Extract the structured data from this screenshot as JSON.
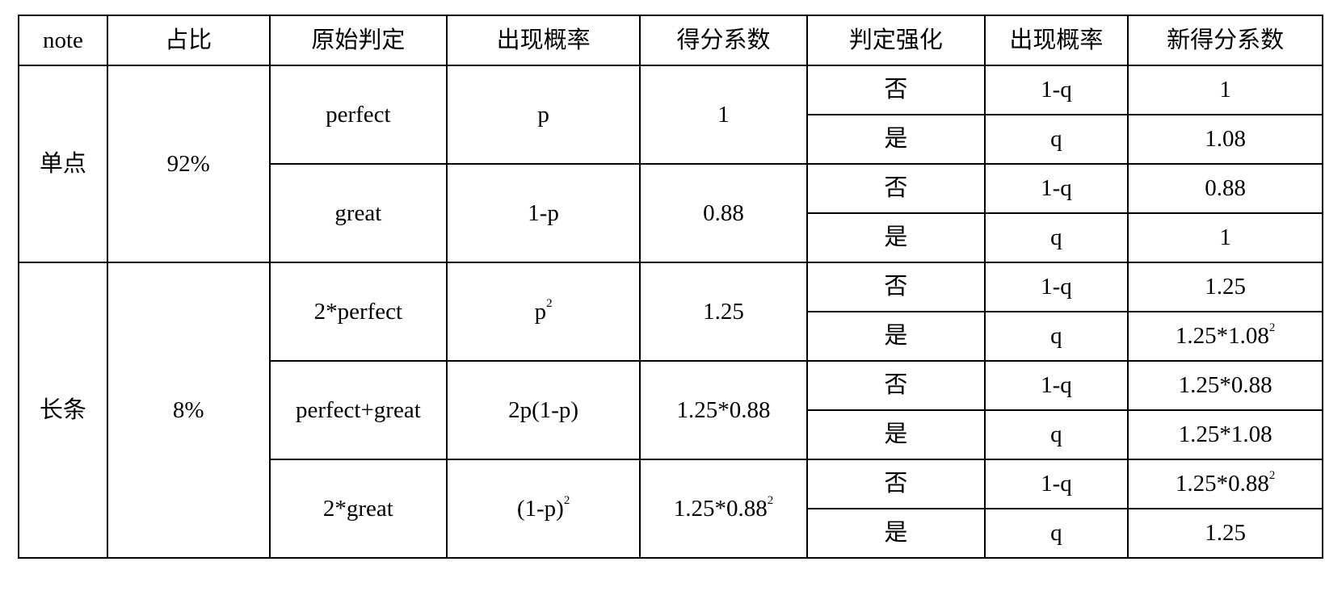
{
  "table": {
    "headers": [
      "note",
      "占比",
      "原始判定",
      "出现概率",
      "得分系数",
      "判定强化",
      "出现概率",
      "新得分系数"
    ],
    "groups": [
      {
        "note": "单点",
        "ratio": "92%",
        "judgements": [
          {
            "judge": "perfect",
            "prob": "p",
            "coef": "1",
            "options": [
              {
                "enhanced": "否",
                "prob": "1-q",
                "new_coef": "1"
              },
              {
                "enhanced": "是",
                "prob": "q",
                "new_coef": "1.08"
              }
            ]
          },
          {
            "judge": "great",
            "prob": "1-p",
            "coef": "0.88",
            "options": [
              {
                "enhanced": "否",
                "prob": "1-q",
                "new_coef": "0.88"
              },
              {
                "enhanced": "是",
                "prob": "q",
                "new_coef": "1"
              }
            ]
          }
        ]
      },
      {
        "note": "长条",
        "ratio": "8%",
        "judgements": [
          {
            "judge": "2*perfect",
            "prob": "p",
            "prob_sup": "2",
            "coef": "1.25",
            "options": [
              {
                "enhanced": "否",
                "prob": "1-q",
                "new_coef": "1.25"
              },
              {
                "enhanced": "是",
                "prob": "q",
                "new_coef": "1.25*1.08",
                "new_coef_sup": "2"
              }
            ]
          },
          {
            "judge": "perfect+great",
            "prob": "2p(1-p)",
            "coef": "1.25*0.88",
            "options": [
              {
                "enhanced": "否",
                "prob": "1-q",
                "new_coef": "1.25*0.88"
              },
              {
                "enhanced": "是",
                "prob": "q",
                "new_coef": "1.25*1.08"
              }
            ]
          },
          {
            "judge": "2*great",
            "prob": "(1-p)",
            "prob_sup": "2",
            "coef": "1.25*0.88",
            "coef_sup": "2",
            "options": [
              {
                "enhanced": "否",
                "prob": "1-q",
                "new_coef": "1.25*0.88",
                "new_coef_sup": "2"
              },
              {
                "enhanced": "是",
                "prob": "q",
                "new_coef": "1.25"
              }
            ]
          }
        ]
      }
    ]
  }
}
